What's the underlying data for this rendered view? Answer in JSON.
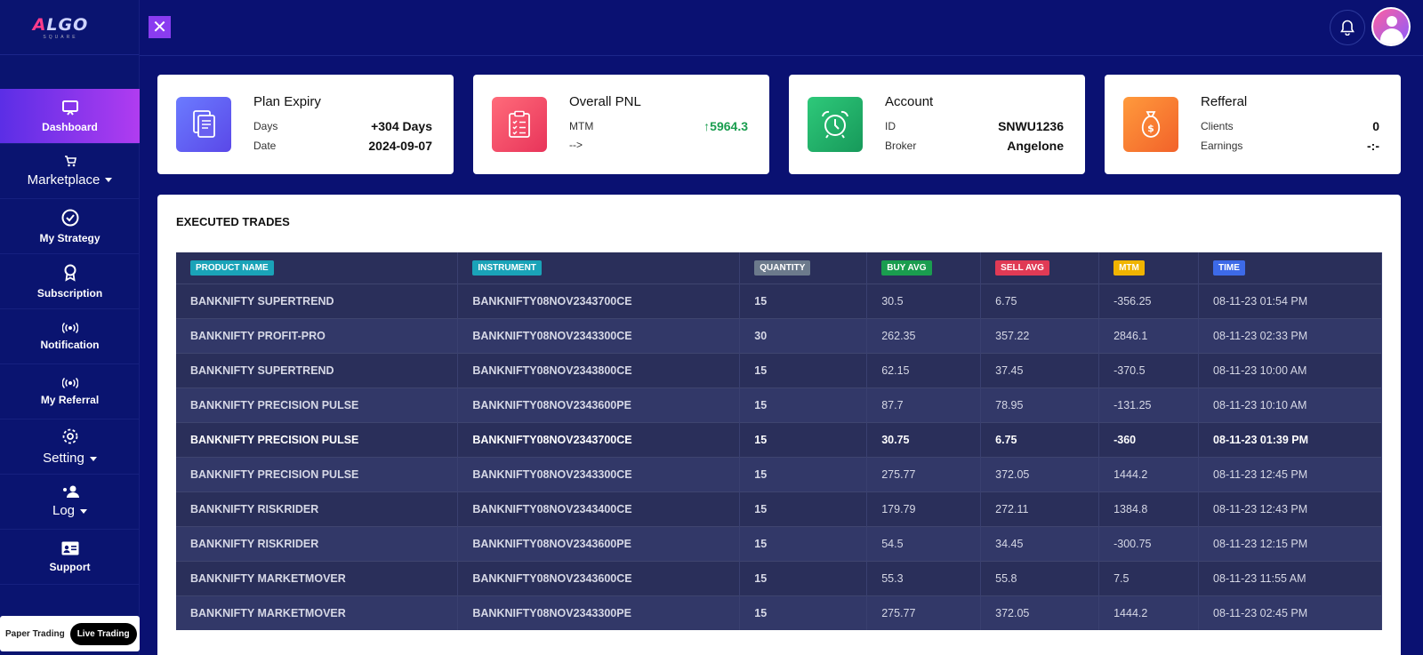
{
  "logo": {
    "text_a": "A",
    "text_rest": "LGO",
    "sub": "SQUARE"
  },
  "sidebar": {
    "items": [
      {
        "label": "Dashboard",
        "icon": "monitor-icon"
      },
      {
        "label": "Marketplace",
        "icon": "cart-icon"
      },
      {
        "label": "My Strategy",
        "icon": "check-circle-icon"
      },
      {
        "label": "Subscription",
        "icon": "award-icon"
      },
      {
        "label": "Notification",
        "icon": "broadcast-icon"
      },
      {
        "label": "My Referral",
        "icon": "broadcast-icon"
      },
      {
        "label": "Setting",
        "icon": "gear-icon"
      },
      {
        "label": "Log",
        "icon": "users-icon"
      },
      {
        "label": "Support",
        "icon": "id-card-icon"
      }
    ],
    "paper_label": "Paper Trading",
    "live_label": "Live Trading"
  },
  "header": {
    "close_glyph": "✕"
  },
  "cards": {
    "plan": {
      "title": "Plan Expiry",
      "r1_label": "Days",
      "r1_value": "+304 Days",
      "r2_label": "Date",
      "r2_value": "2024-09-07"
    },
    "pnl": {
      "title": "Overall PNL",
      "r1_label": "MTM",
      "r1_value": "5964.3",
      "r2_label": "-->",
      "r2_value": ""
    },
    "account": {
      "title": "Account",
      "r1_label": "ID",
      "r1_value": "SNWU1236",
      "r2_label": "Broker",
      "r2_value": "Angelone"
    },
    "referral": {
      "title": "Refferal",
      "r1_label": "Clients",
      "r1_value": "0",
      "r2_label": "Earnings",
      "r2_value": "-:-"
    }
  },
  "trades": {
    "title": "EXECUTED TRADES",
    "columns": [
      {
        "label": "PRODUCT NAME",
        "color": "#1aa3b8"
      },
      {
        "label": "INSTRUMENT",
        "color": "#1aa3b8"
      },
      {
        "label": "QUANTITY",
        "color": "#6c7a8c"
      },
      {
        "label": "BUY AVG",
        "color": "#1a9d4f"
      },
      {
        "label": "SELL AVG",
        "color": "#e03a55"
      },
      {
        "label": "MTM",
        "color": "#f0b400"
      },
      {
        "label": "TIME",
        "color": "#3d6ae8"
      }
    ],
    "rows": [
      [
        "BANKNIFTY SUPERTREND",
        "BANKNIFTY08NOV2343700CE",
        "15",
        "30.5",
        "6.75",
        "-356.25",
        "08-11-23 01:54 PM"
      ],
      [
        "BANKNIFTY PROFIT-PRO",
        "BANKNIFTY08NOV2343300CE",
        "30",
        "262.35",
        "357.22",
        "2846.1",
        "08-11-23 02:33 PM"
      ],
      [
        "BANKNIFTY SUPERTREND",
        "BANKNIFTY08NOV2343800CE",
        "15",
        "62.15",
        "37.45",
        "-370.5",
        "08-11-23 10:00 AM"
      ],
      [
        "BANKNIFTY PRECISION PULSE",
        "BANKNIFTY08NOV2343600PE",
        "15",
        "87.7",
        "78.95",
        "-131.25",
        "08-11-23 10:10 AM"
      ],
      [
        "BANKNIFTY PRECISION PULSE",
        "BANKNIFTY08NOV2343700CE",
        "15",
        "30.75",
        "6.75",
        "-360",
        "08-11-23 01:39 PM"
      ],
      [
        "BANKNIFTY PRECISION PULSE",
        "BANKNIFTY08NOV2343300CE",
        "15",
        "275.77",
        "372.05",
        "1444.2",
        "08-11-23 12:45 PM"
      ],
      [
        "BANKNIFTY RISKRIDER",
        "BANKNIFTY08NOV2343400CE",
        "15",
        "179.79",
        "272.11",
        "1384.8",
        "08-11-23 12:43 PM"
      ],
      [
        "BANKNIFTY RISKRIDER",
        "BANKNIFTY08NOV2343600PE",
        "15",
        "54.5",
        "34.45",
        "-300.75",
        "08-11-23 12:15 PM"
      ],
      [
        "BANKNIFTY MARKETMOVER",
        "BANKNIFTY08NOV2343600CE",
        "15",
        "55.3",
        "55.8",
        "7.5",
        "08-11-23 11:55 AM"
      ],
      [
        "BANKNIFTY MARKETMOVER",
        "BANKNIFTY08NOV2343300PE",
        "15",
        "275.77",
        "372.05",
        "1444.2",
        "08-11-23 02:45 PM"
      ]
    ]
  }
}
